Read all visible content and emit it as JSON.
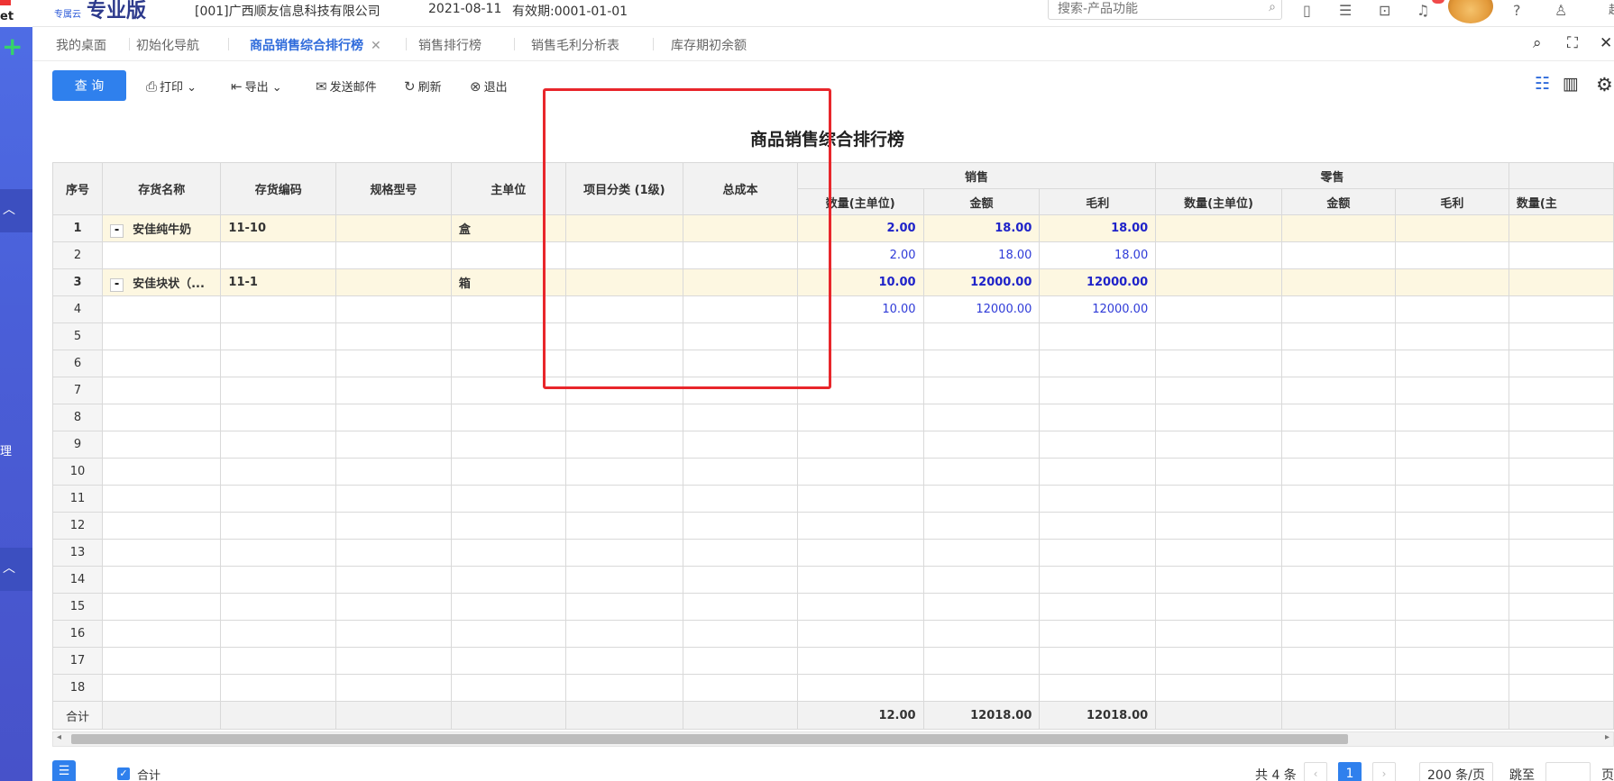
{
  "header": {
    "brand": "专业版",
    "brand_small": "专属云",
    "company": "[001]广西顺友信息科技有限公司",
    "date": "2021-08-11",
    "validity": "有效期:0001-01-01",
    "search_placeholder": "搜索-产品功能",
    "user": "赵"
  },
  "rail": {
    "logo_text": "et",
    "side_label": "理"
  },
  "tabs": [
    {
      "label": "我的桌面"
    },
    {
      "label": "初始化导航"
    },
    {
      "label": "商品销售综合排行榜",
      "active": true
    },
    {
      "label": "销售排行榜"
    },
    {
      "label": "销售毛利分析表"
    },
    {
      "label": "库存期初余额"
    }
  ],
  "toolbar": {
    "query": "查 询",
    "print": "打印",
    "export": "导出",
    "send_mail": "发送邮件",
    "refresh": "刷新",
    "exit": "退出"
  },
  "report": {
    "title": "商品销售综合排行榜",
    "headers": {
      "index": "序号",
      "name": "存货名称",
      "code": "存货编码",
      "spec": "规格型号",
      "unit": "主单位",
      "category": "项目分类 (1级)",
      "total_cost": "总成本",
      "group_sales": "销售",
      "group_retail": "零售",
      "qty": "数量(主单位)",
      "amount": "金额",
      "profit": "毛利",
      "qty_cut": "数量(主"
    },
    "rows": [
      {
        "idx": "1",
        "type": "parent",
        "name": "安佳纯牛奶",
        "code": "11-10",
        "unit": "盒",
        "qty": "2.00",
        "amount": "18.00",
        "profit": "18.00"
      },
      {
        "idx": "2",
        "type": "child",
        "name": "",
        "code": "",
        "unit": "",
        "qty": "2.00",
        "amount": "18.00",
        "profit": "18.00"
      },
      {
        "idx": "3",
        "type": "parent",
        "name": "安佳块状（...",
        "code": "11-1",
        "unit": "箱",
        "qty": "10.00",
        "amount": "12000.00",
        "profit": "12000.00"
      },
      {
        "idx": "4",
        "type": "child",
        "name": "",
        "code": "",
        "unit": "",
        "qty": "10.00",
        "amount": "12000.00",
        "profit": "12000.00"
      },
      {
        "idx": "5"
      },
      {
        "idx": "6"
      },
      {
        "idx": "7"
      },
      {
        "idx": "8"
      },
      {
        "idx": "9"
      },
      {
        "idx": "10"
      },
      {
        "idx": "11"
      },
      {
        "idx": "12"
      },
      {
        "idx": "13"
      },
      {
        "idx": "14"
      },
      {
        "idx": "15"
      },
      {
        "idx": "16"
      },
      {
        "idx": "17"
      },
      {
        "idx": "18"
      }
    ],
    "totals": {
      "label": "合计",
      "qty": "12.00",
      "amount": "12018.00",
      "profit": "12018.00"
    }
  },
  "footer": {
    "total_toggle": "合计",
    "count": "共 4 条",
    "current_page": "1",
    "page_size": "200 条/页",
    "jump": "跳至",
    "page_suffix": "页"
  }
}
